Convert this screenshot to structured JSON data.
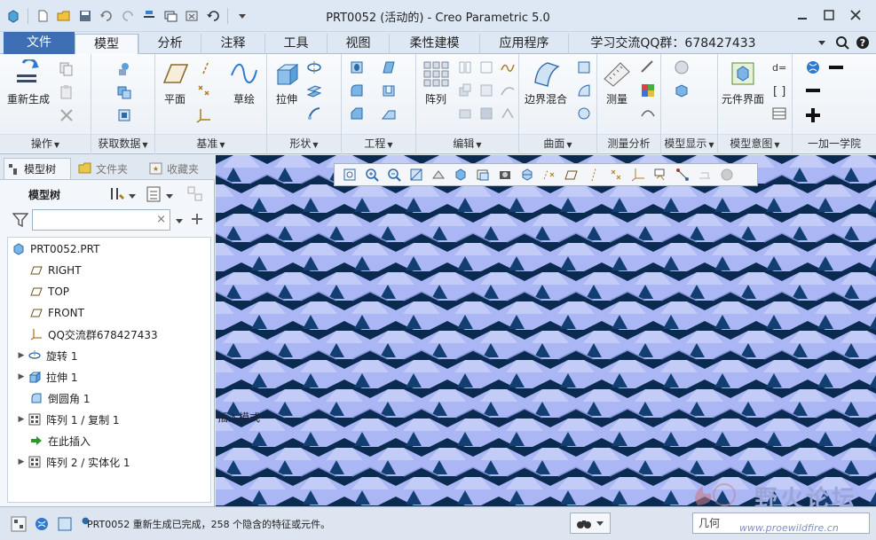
{
  "window": {
    "title": "PRT0052 (活动的) - Creo Parametric 5.0"
  },
  "tabs": [
    {
      "label": "文件"
    },
    {
      "label": "模型"
    },
    {
      "label": "分析"
    },
    {
      "label": "注释"
    },
    {
      "label": "工具"
    },
    {
      "label": "视图"
    },
    {
      "label": "柔性建模"
    },
    {
      "label": "应用程序"
    },
    {
      "label": "学习交流QQ群：678427433"
    }
  ],
  "ribbon": {
    "groups": {
      "operations": "操作",
      "get_data": "获取数据",
      "datum": "基准",
      "shapes": "形状",
      "engineering": "工程",
      "editing": "编辑",
      "surfaces": "曲面",
      "measure_analysis": "测量分析",
      "model_display": "模型显示",
      "model_intent": "模型意图",
      "academy": "一加一学院"
    },
    "buttons": {
      "regenerate": "重新生成",
      "plane": "平面",
      "sketch": "草绘",
      "extrude": "拉伸",
      "pattern": "阵列",
      "boundary_blend": "边界混合",
      "measure": "测量",
      "component_interface": "元件界面"
    }
  },
  "left_panel": {
    "tabs": [
      "模型树",
      "文件夹",
      "收藏夹"
    ],
    "title": "模型树",
    "search_placeholder": "",
    "tree": [
      {
        "label": "PRT0052.PRT",
        "icon": "part-icon",
        "expandable": false
      },
      {
        "label": "RIGHT",
        "icon": "datum-plane-icon",
        "expandable": false
      },
      {
        "label": "TOP",
        "icon": "datum-plane-icon",
        "expandable": false
      },
      {
        "label": "FRONT",
        "icon": "datum-plane-icon",
        "expandable": false
      },
      {
        "label": "QQ交流群678427433",
        "icon": "csys-icon",
        "expandable": false
      },
      {
        "label": "旋转 1",
        "icon": "revolve-icon",
        "expandable": true
      },
      {
        "label": "拉伸 1",
        "icon": "extrude-icon",
        "expandable": true
      },
      {
        "label": "倒圆角 1",
        "icon": "round-icon",
        "expandable": false
      },
      {
        "label": "阵列 1 / 复制 1",
        "icon": "pattern-icon",
        "expandable": true
      },
      {
        "label": "在此插入",
        "icon": "insert-arrow-icon",
        "expandable": false
      },
      {
        "label": "阵列 2 / 实体化 1",
        "icon": "pattern-icon",
        "expandable": true
      }
    ]
  },
  "graphics": {
    "insert_mode_label": "插入模式",
    "watermark_text": "野火论坛",
    "watermark_url": "www.proewildfire.cn"
  },
  "status": {
    "message": "PRT0052 重新生成已完成，258 个隐含的特征或元件。",
    "selection_filter": "几何"
  },
  "colors": {
    "accent": "#3e6eb3",
    "model_surface": "#a9b6f2",
    "model_holes": "#0a2a50"
  }
}
